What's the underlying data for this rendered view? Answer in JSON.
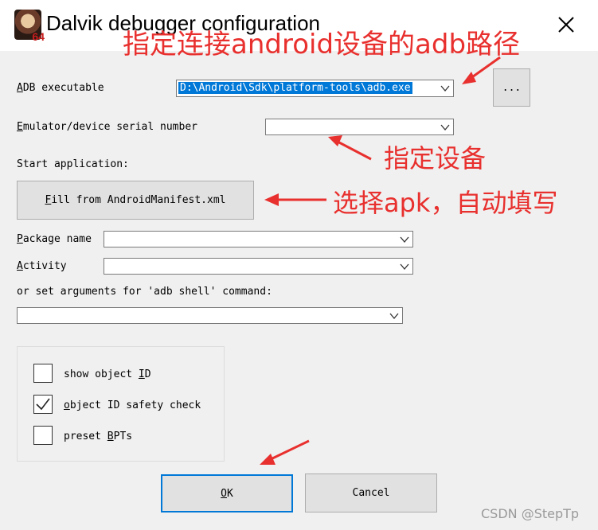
{
  "window": {
    "title": "Dalvik debugger configuration",
    "icon_badge": "64",
    "close_icon": "close-icon"
  },
  "annotations": {
    "adb_path_note": "指定连接android设备的adb路径",
    "device_note": "指定设备",
    "apk_note": "选择apk，自动填写",
    "accent_color": "#e8302e"
  },
  "form": {
    "adb_label": {
      "accel": "A",
      "rest": "DB executable"
    },
    "adb_value": "D:\\Android\\Sdk\\platform-tools\\adb.exe",
    "browse_label": "...",
    "serial_label": {
      "accel": "E",
      "rest": "mulator/device serial number"
    },
    "serial_value": "",
    "start_app_label": "Start application:",
    "fill_button": {
      "accel": "F",
      "rest": "ill from AndroidManifest.xml"
    },
    "package_label": {
      "accel": "P",
      "rest": "ackage name"
    },
    "package_value": "",
    "activity_label": {
      "accel": "A",
      "rest": "ctivity"
    },
    "activity_value": "",
    "args_label": "or set arguments for 'adb shell' command:",
    "args_value": ""
  },
  "options": [
    {
      "pre": "show object ",
      "accel": "I",
      "post": "D",
      "checked": false
    },
    {
      "pre": "",
      "accel": "o",
      "post": "bject ID safety check",
      "checked": true
    },
    {
      "pre": "preset ",
      "accel": "B",
      "post": "PTs",
      "checked": false
    }
  ],
  "buttons": {
    "ok": {
      "accel": "O",
      "rest": "K"
    },
    "cancel": "Cancel"
  },
  "watermark": "CSDN @StepTp"
}
